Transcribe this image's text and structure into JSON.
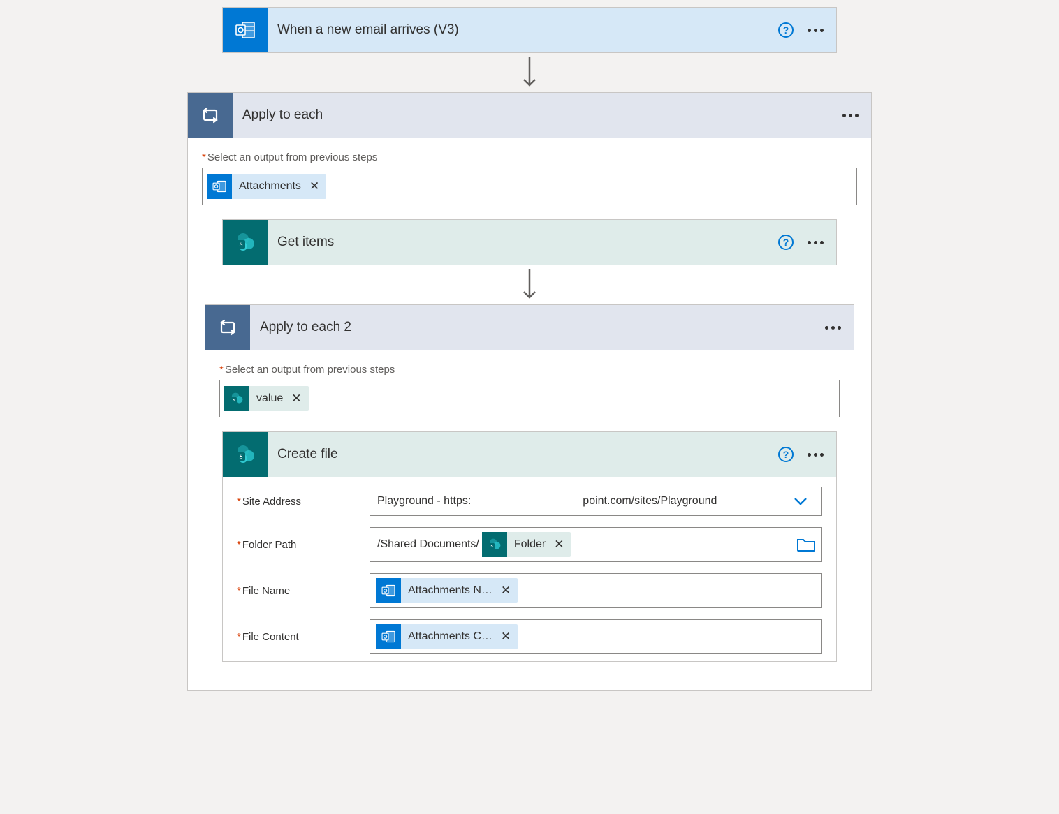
{
  "trigger": {
    "title": "When a new email arrives (V3)"
  },
  "apply1": {
    "title": "Apply to each",
    "selectLabel": "Select an output from previous steps",
    "token": "Attachments"
  },
  "getItems": {
    "title": "Get items"
  },
  "apply2": {
    "title": "Apply to each 2",
    "selectLabel": "Select an output from previous steps",
    "token": "value"
  },
  "createFile": {
    "title": "Create file",
    "fields": {
      "siteLabel": "Site Address",
      "siteValueA": "Playground - https:",
      "siteValueB": "point.com/sites/Playground",
      "folderLabel": "Folder Path",
      "folderPrefix": "/Shared Documents/",
      "folderToken": "Folder",
      "fileNameLabel": "File Name",
      "fileNameToken": "Attachments N…",
      "fileContentLabel": "File Content",
      "fileContentToken": "Attachments C…"
    }
  }
}
